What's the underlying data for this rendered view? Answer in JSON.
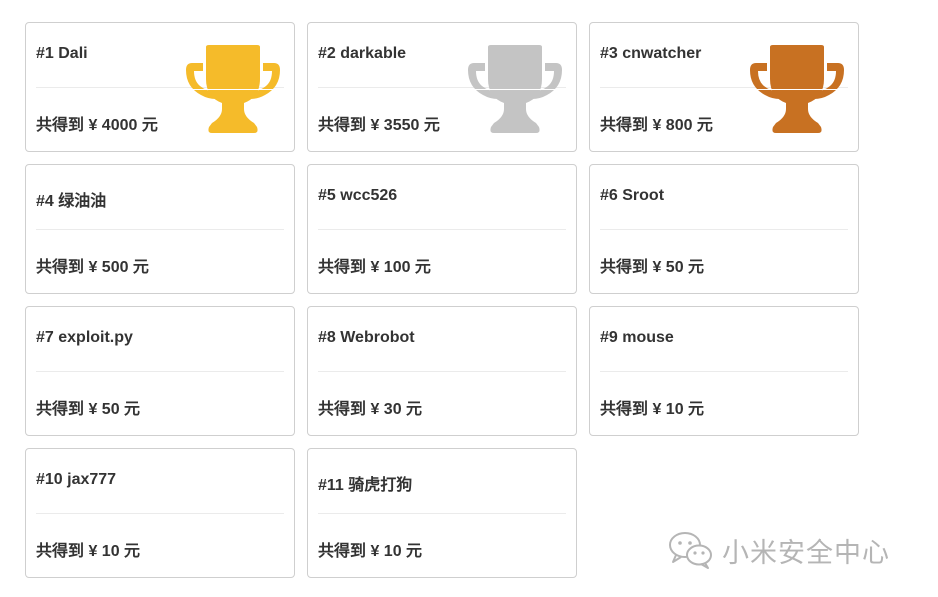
{
  "cards": [
    {
      "rank": "#1 Dali",
      "amount": "共得到 ¥ 4000 元",
      "trophy": "gold"
    },
    {
      "rank": "#2 darkable",
      "amount": "共得到 ¥ 3550 元",
      "trophy": "silver"
    },
    {
      "rank": "#3 cnwatcher",
      "amount": "共得到 ¥ 800 元",
      "trophy": "bronze"
    },
    {
      "rank": "#4 绿油油",
      "amount": "共得到 ¥ 500 元"
    },
    {
      "rank": "#5 wcc526",
      "amount": "共得到 ¥ 100 元"
    },
    {
      "rank": "#6 Sroot",
      "amount": "共得到 ¥ 50 元"
    },
    {
      "rank": "#7 exploit.py",
      "amount": "共得到 ¥ 50 元"
    },
    {
      "rank": "#8 Webrobot",
      "amount": "共得到 ¥ 30 元"
    },
    {
      "rank": "#9 mouse",
      "amount": "共得到 ¥ 10 元"
    },
    {
      "rank": "#10 jax777",
      "amount": "共得到 ¥ 10 元"
    },
    {
      "rank": "#11 骑虎打狗",
      "amount": "共得到 ¥ 10 元"
    }
  ],
  "colors": {
    "gold": "#f5bb2a",
    "silver": "#c4c4c4",
    "bronze": "#c87122",
    "watermark": "#b5b5b5"
  },
  "icons": {
    "trophy": "trophy-icon",
    "wechat": "wechat-icon"
  },
  "watermark": {
    "text": "小米安全中心"
  }
}
